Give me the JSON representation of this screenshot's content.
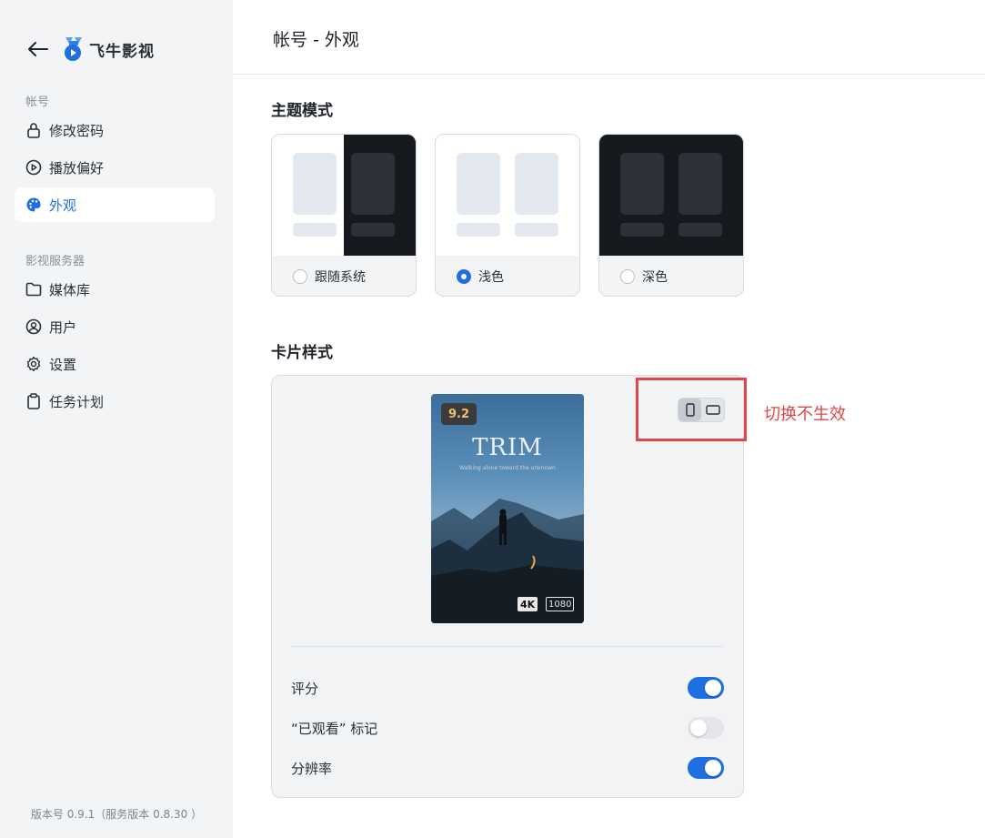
{
  "brand": {
    "name": "飞牛影视"
  },
  "sidebar": {
    "account_section": "帐号",
    "account_items": [
      {
        "label": "修改密码",
        "icon": "lock-icon"
      },
      {
        "label": "播放偏好",
        "icon": "play-circle-icon"
      },
      {
        "label": "外观",
        "icon": "palette-icon",
        "active": true
      }
    ],
    "server_section": "影视服务器",
    "server_items": [
      {
        "label": "媒体库",
        "icon": "folder-icon"
      },
      {
        "label": "用户",
        "icon": "user-icon"
      },
      {
        "label": "设置",
        "icon": "gear-icon"
      },
      {
        "label": "任务计划",
        "icon": "clipboard-icon"
      }
    ],
    "version": "版本号 0.9.1（服务版本 0.8.30 ）"
  },
  "header": {
    "title": "帐号 - 外观"
  },
  "theme": {
    "title": "主题模式",
    "options": [
      {
        "label": "跟随系统",
        "selected": false
      },
      {
        "label": "浅色",
        "selected": true
      },
      {
        "label": "深色",
        "selected": false
      }
    ]
  },
  "card_style": {
    "title": "卡片样式",
    "poster": {
      "rating": "9.2",
      "title": "TRIM",
      "subtitle": "Walking alone toward the unknown",
      "res_4k": "4K",
      "res_1080": "1080"
    },
    "layout_selected": "portrait",
    "toggles": [
      {
        "label": "评分",
        "on": true
      },
      {
        "label": "“已观看” 标记",
        "on": false
      },
      {
        "label": "分辨率",
        "on": true
      }
    ]
  },
  "annotation": {
    "note": "切换不生效"
  },
  "colors": {
    "accent": "#1f6fe0",
    "annotation": "#e04646",
    "sidebar_bg": "#f3f4f6"
  }
}
